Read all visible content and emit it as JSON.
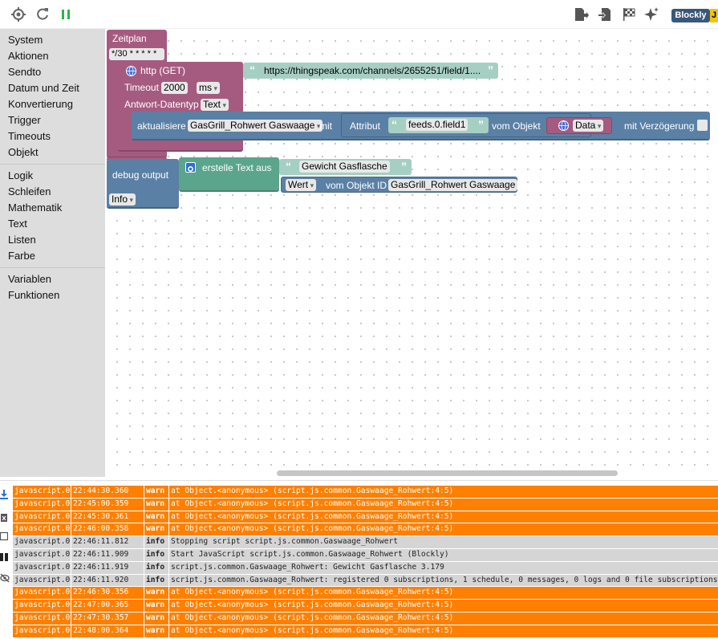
{
  "toolbar": {
    "icons": [
      "target-icon",
      "refresh-icon",
      "pause-icon",
      "export-icon",
      "import-icon",
      "checkered-flag-icon",
      "sparkle-icon"
    ],
    "badge": "Blockly",
    "badge_tail": "J",
    "colors": {
      "pause": "#2db34a",
      "badge": "#39577a",
      "badge_tail": "#f5c400"
    }
  },
  "sidebar": {
    "groups": [
      [
        "System",
        "Aktionen",
        "Sendto",
        "Datum und Zeit",
        "Konvertierung",
        "Trigger",
        "Timeouts",
        "Objekt"
      ],
      [
        "Logik",
        "Schleifen",
        "Mathematik",
        "Text",
        "Listen",
        "Farbe"
      ],
      [
        "Variablen",
        "Funktionen"
      ]
    ]
  },
  "blocks": {
    "schedule": {
      "title": "Zeitplan",
      "cron": "*/30 * * * * *",
      "color": "#a55b80"
    },
    "http": {
      "title": "http (GET)",
      "url": "https://thingspeak.com/channels/2655251/field/1....",
      "timeout_label": "Timeout",
      "timeout_value": "2000",
      "timeout_unit": "ms",
      "type_label": "Antwort-Datentyp",
      "type_value": "Text",
      "color": "#a55b80"
    },
    "update": {
      "label": "aktualisiere",
      "object": "GasGrill_Rohwert Gaswaage",
      "mit": "mit",
      "attr_label": "Attribut",
      "attr_value": "feeds.0.field1",
      "from_label": "vom Objekt",
      "data_value": "Data",
      "delay_label": "mit Verzögerung",
      "color": "#5b80a5"
    },
    "debug": {
      "label": "debug output",
      "level": "Info",
      "create_text": "erstelle Text aus",
      "text1": "Gewicht Gasflasche",
      "value_label": "Wert",
      "obj_id_label": "vom Objekt ID",
      "obj_id_value": "GasGrill_Rohwert Gaswaage",
      "color": "#5b80a5",
      "text_color": "#5ba58c"
    }
  },
  "log": {
    "icons": [
      "download-icon",
      "clear-log-icon",
      "window-icon",
      "columns-icon",
      "eye-off-icon"
    ],
    "colors": {
      "warn": "#ff8000",
      "info": "#d5d5d5"
    },
    "rows": [
      {
        "source": "javascript.0",
        "time": "22:44:30.360",
        "level": "warn",
        "message": "at Object.<anonymous> (script.js.common.Gaswaage_Rohwert:4:5)"
      },
      {
        "source": "javascript.0",
        "time": "22:45:00.359",
        "level": "warn",
        "message": "at Object.<anonymous> (script.js.common.Gaswaage_Rohwert:4:5)"
      },
      {
        "source": "javascript.0",
        "time": "22:45:30.361",
        "level": "warn",
        "message": "at Object.<anonymous> (script.js.common.Gaswaage_Rohwert:4:5)"
      },
      {
        "source": "javascript.0",
        "time": "22:46:00.358",
        "level": "warn",
        "message": "at Object.<anonymous> (script.js.common.Gaswaage_Rohwert:4:5)"
      },
      {
        "source": "javascript.0",
        "time": "22:46:11.812",
        "level": "info",
        "message": "Stopping script script.js.common.Gaswaage_Rohwert"
      },
      {
        "source": "javascript.0",
        "time": "22:46:11.909",
        "level": "info",
        "message": "Start JavaScript script.js.common.Gaswaage_Rohwert (Blockly)"
      },
      {
        "source": "javascript.0",
        "time": "22:46:11.919",
        "level": "info",
        "message": "script.js.common.Gaswaage_Rohwert: Gewicht Gasflasche 3.179"
      },
      {
        "source": "javascript.0",
        "time": "22:46:11.920",
        "level": "info",
        "message": "script.js.common.Gaswaage_Rohwert: registered 0 subscriptions, 1 schedule, 0 messages, 0 logs and 0 file subscriptions"
      },
      {
        "source": "javascript.0",
        "time": "22:46:30.356",
        "level": "warn",
        "message": "at Object.<anonymous> (script.js.common.Gaswaage_Rohwert:4:5)"
      },
      {
        "source": "javascript.0",
        "time": "22:47:00.365",
        "level": "warn",
        "message": "at Object.<anonymous> (script.js.common.Gaswaage_Rohwert:4:5)"
      },
      {
        "source": "javascript.0",
        "time": "22:47:30.357",
        "level": "warn",
        "message": "at Object.<anonymous> (script.js.common.Gaswaage_Rohwert:4:5)"
      },
      {
        "source": "javascript.0",
        "time": "22:48:00.364",
        "level": "warn",
        "message": "at Object.<anonymous> (script.js.common.Gaswaage_Rohwert:4:5)"
      }
    ]
  }
}
